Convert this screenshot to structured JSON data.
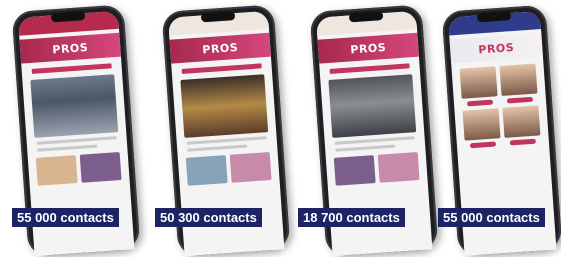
{
  "brand": {
    "name": "PROS",
    "accent_color": "#c2355f",
    "badge_color": "#1d2466"
  },
  "phones": [
    {
      "contacts_label": "55 000 contacts"
    },
    {
      "contacts_label": "50 300 contacts"
    },
    {
      "contacts_label": "18 700 contacts"
    },
    {
      "contacts_label": "55 000 contacts"
    }
  ]
}
